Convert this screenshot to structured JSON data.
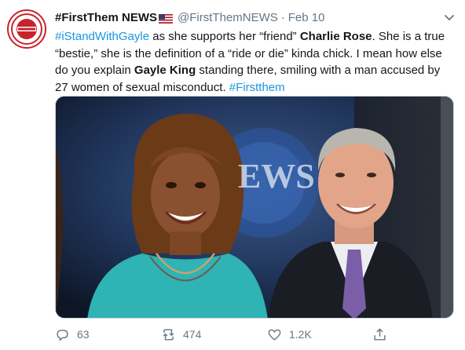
{
  "tweet": {
    "display_name": "#FirstThem NEWS",
    "handle": "@FirstThemNEWS",
    "separator": "·",
    "date": "Feb 10",
    "avatar_text": "ACCOUNTABILITY",
    "text": {
      "hashtag1": "#iStandWithGayle",
      "part1": " as she supports her  “friend”  ",
      "name1": "Charlie Rose",
      "part2": ". She is a true  “bestie,”  she is the definition of a  “ride or die”  kinda chick. I mean how else do you explain ",
      "name2": "Gayle King",
      "part3": " standing there, smiling with a man accused by 27 women of sexual misconduct. ",
      "hashtag2": "#Firstthem"
    },
    "media": {
      "backdrop_text": "EWS"
    },
    "actions": {
      "replies": "63",
      "retweets": "474",
      "likes": "1.2K"
    }
  },
  "colors": {
    "link": "#1b95e0",
    "secondary": "#657786",
    "accent_red": "#c8232c"
  },
  "icons": [
    "caret-down-icon",
    "reply-icon",
    "retweet-icon",
    "like-icon",
    "share-icon",
    "us-flag-icon"
  ]
}
